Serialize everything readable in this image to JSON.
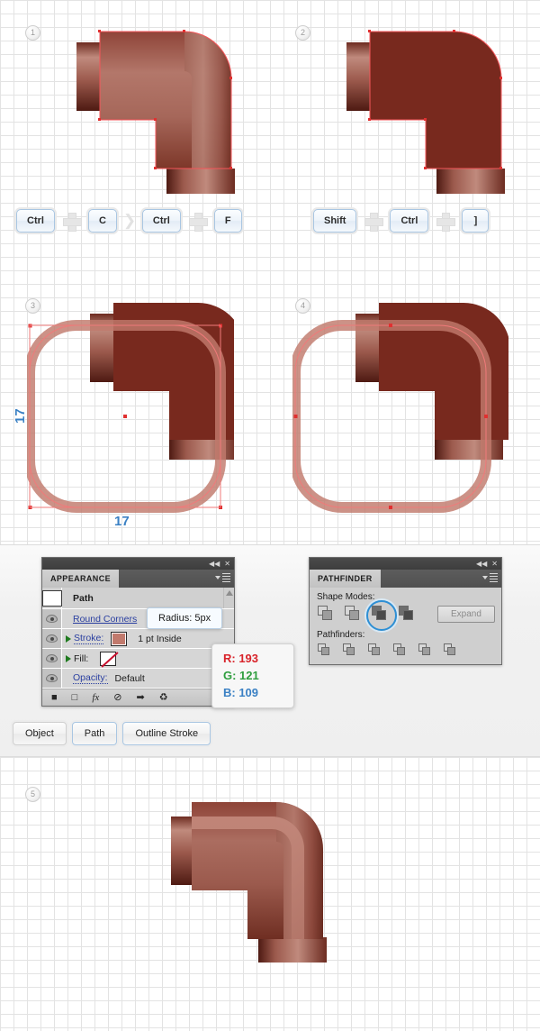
{
  "steps": [
    {
      "num": "1"
    },
    {
      "num": "2"
    },
    {
      "num": "3"
    },
    {
      "num": "4"
    },
    {
      "num": "5"
    }
  ],
  "shortcuts": {
    "row1": [
      "Ctrl",
      "C",
      "Ctrl",
      "F"
    ],
    "row2": [
      "Shift",
      "Ctrl",
      "]"
    ]
  },
  "dimensions": {
    "vertical": "17",
    "horizontal": "17"
  },
  "appearance": {
    "tab": "APPEARANCE",
    "path_label": "Path",
    "round_corners": "Round Corners",
    "radius_tooltip": "Radius: 5px",
    "stroke_label": "Stroke:",
    "stroke_value": "1 pt  Inside",
    "fill_label": "Fill:",
    "opacity_label": "Opacity:",
    "opacity_value": "Default",
    "footer_icons": [
      "new-fill-icon",
      "new-stroke-icon",
      "add-effect-icon",
      "clear-appearance-icon",
      "duplicate-item-icon",
      "delete-item-icon"
    ],
    "collapse_icon": "◀◀",
    "close_icon": "✕"
  },
  "rgb_callout": {
    "r": "R: 193",
    "g": "G: 121",
    "b": "B: 109",
    "color_r": "#d8232a",
    "color_g": "#2f9e3f",
    "color_b": "#3a80c4"
  },
  "pathfinder": {
    "tab": "PATHFINDER",
    "shape_modes_label": "Shape Modes:",
    "pathfinders_label": "Pathfinders:",
    "expand_label": "Expand",
    "shape_mode_icons": [
      "unite-icon",
      "minus-front-icon",
      "intersect-icon",
      "exclude-icon"
    ],
    "selected_shape_mode": "intersect-icon",
    "pathfinder_icons": [
      "divide-icon",
      "trim-icon",
      "merge-icon",
      "crop-icon",
      "outline-icon",
      "minus-back-icon"
    ],
    "collapse_icon": "◀◀",
    "close_icon": "✕"
  },
  "menu_buttons": {
    "object": "Object",
    "path": "Path",
    "outline_stroke": "Outline Stroke"
  },
  "colors": {
    "pipe_light": "#c17a6d",
    "pipe_mid": "#9e5246",
    "pipe_dark": "#6b2a20",
    "pipe_flat": "#78291e",
    "grid_line": "#e3e3e3",
    "accent_blue": "#3a80c4",
    "selection_red": "#f07a7a"
  }
}
